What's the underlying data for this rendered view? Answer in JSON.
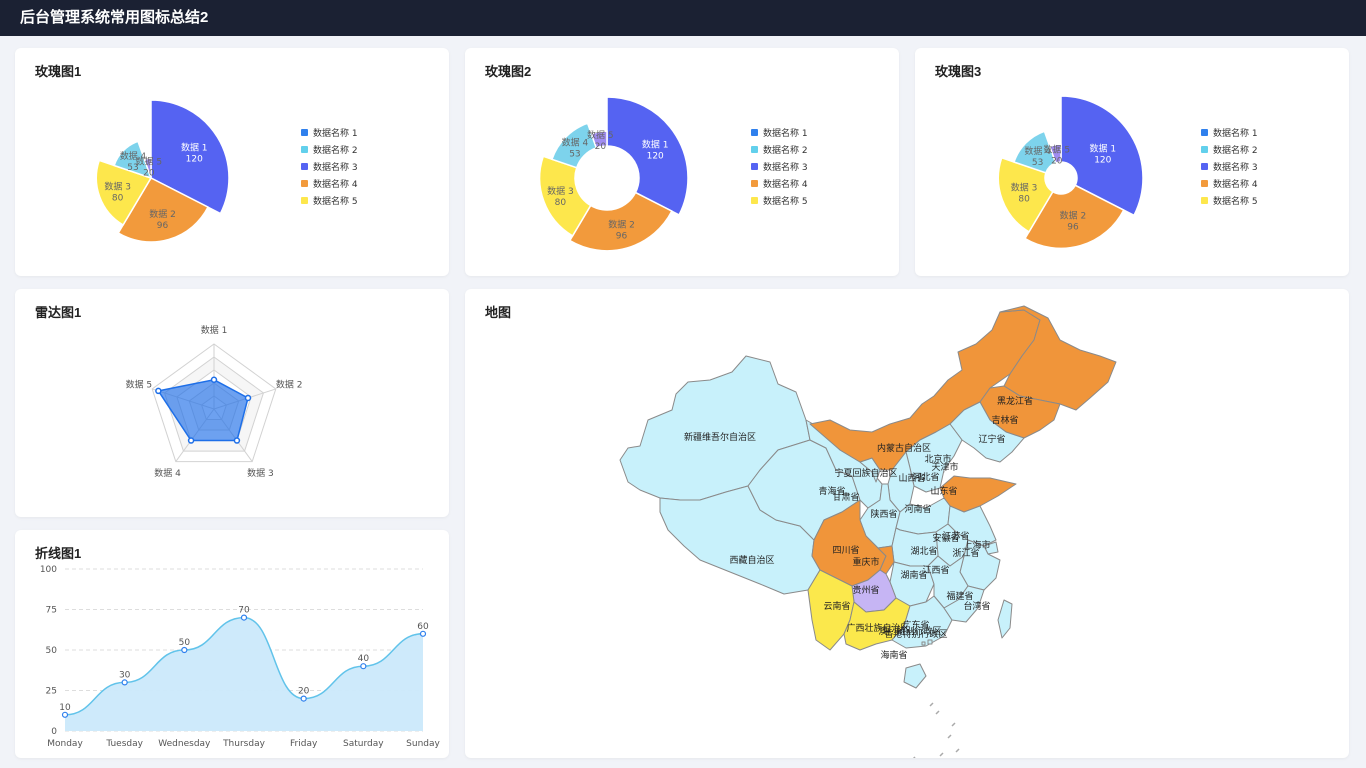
{
  "header": {
    "title": "后台管理系统常用图标总结2"
  },
  "cards": {
    "rose1": {
      "title": "玫瑰图1"
    },
    "rose2": {
      "title": "玫瑰图2"
    },
    "rose3": {
      "title": "玫瑰图3"
    },
    "radar1": {
      "title": "雷达图1"
    },
    "line1": {
      "title": "折线图1"
    },
    "map": {
      "title": "地图"
    }
  },
  "colors": {
    "series": [
      "#2f80ed",
      "#62d0ec",
      "#5563f2",
      "#f29a3c",
      "#fde74c"
    ],
    "rose_fill": {
      "数据 1": "#5563f2",
      "数据 2": "#f29a3c",
      "数据 3": "#fde74c",
      "数据 4": "#7dd3ec",
      "数据 5": "#a08cf0"
    },
    "map_default": "#c8f1fb",
    "map_orange": "#f0953a",
    "map_yellow": "#fbe84c",
    "map_purple": "#c6b5f4",
    "radar": "#1e6fe8",
    "line": "#61c3ea"
  },
  "rose_legend": [
    "数据名称 1",
    "数据名称 2",
    "数据名称 3",
    "数据名称 4",
    "数据名称 5"
  ],
  "chart_data": [
    {
      "type": "pie",
      "title": "玫瑰图1",
      "categories": [
        "数据 1",
        "数据 2",
        "数据 3",
        "数据 4",
        "数据 5"
      ],
      "values": [
        120,
        96,
        80,
        53,
        20
      ],
      "legend": [
        "数据名称 1",
        "数据名称 2",
        "数据名称 3",
        "数据名称 4",
        "数据名称 5"
      ]
    },
    {
      "type": "pie",
      "title": "玫瑰图2",
      "categories": [
        "数据 1",
        "数据 2",
        "数据 3",
        "数据 4",
        "数据 5"
      ],
      "values": [
        120,
        96,
        80,
        53,
        20
      ],
      "legend": [
        "数据名称 1",
        "数据名称 2",
        "数据名称 3",
        "数据名称 4",
        "数据名称 5"
      ]
    },
    {
      "type": "pie",
      "title": "玫瑰图3",
      "categories": [
        "数据 1",
        "数据 2",
        "数据 3",
        "数据 4",
        "数据 5"
      ],
      "values": [
        120,
        96,
        80,
        53,
        20
      ],
      "legend": [
        "数据名称 1",
        "数据名称 2",
        "数据名称 3",
        "数据名称 4",
        "数据名称 5"
      ]
    },
    {
      "type": "radar",
      "title": "雷达图1",
      "categories": [
        "数据 1",
        "数据 2",
        "数据 3",
        "数据 4",
        "数据 5"
      ],
      "values": [
        45,
        55,
        60,
        60,
        90
      ],
      "ylim": [
        0,
        100
      ]
    },
    {
      "type": "area",
      "title": "折线图1",
      "categories": [
        "Monday",
        "Tuesday",
        "Wednesday",
        "Thursday",
        "Friday",
        "Saturday",
        "Sunday"
      ],
      "values": [
        10,
        30,
        50,
        70,
        20,
        40,
        60
      ],
      "yticks": [
        0,
        25,
        50,
        75,
        100
      ],
      "ylim": [
        0,
        100
      ],
      "grid": true
    }
  ],
  "map": {
    "regions": [
      {
        "name": "新疆维吾尔自治区"
      },
      {
        "name": "西藏自治区"
      },
      {
        "name": "青海省"
      },
      {
        "name": "甘肃省"
      },
      {
        "name": "宁夏回族自治区"
      },
      {
        "name": "内蒙古自治区",
        "highlight": "orange"
      },
      {
        "name": "黑龙江省",
        "highlight": "orange"
      },
      {
        "name": "吉林省",
        "highlight": "orange"
      },
      {
        "name": "辽宁省"
      },
      {
        "name": "北京市"
      },
      {
        "name": "天津市"
      },
      {
        "name": "河北省"
      },
      {
        "name": "山西省"
      },
      {
        "name": "山东省",
        "highlight": "orange"
      },
      {
        "name": "陕西省"
      },
      {
        "name": "河南省"
      },
      {
        "name": "江苏省"
      },
      {
        "name": "安徽省"
      },
      {
        "name": "上海市"
      },
      {
        "name": "浙江省"
      },
      {
        "name": "湖北省"
      },
      {
        "name": "四川省",
        "highlight": "orange"
      },
      {
        "name": "重庆市",
        "highlight": "orange"
      },
      {
        "name": "湖南省"
      },
      {
        "name": "江西省"
      },
      {
        "name": "贵州省",
        "highlight": "purple"
      },
      {
        "name": "云南省",
        "highlight": "yellow"
      },
      {
        "name": "广西壮族自治区",
        "highlight": "yellow"
      },
      {
        "name": "广东省"
      },
      {
        "name": "福建省"
      },
      {
        "name": "台湾省"
      },
      {
        "name": "海南省"
      },
      {
        "name": "香港特别行政区"
      },
      {
        "name": "澳门特别行政区"
      }
    ]
  }
}
